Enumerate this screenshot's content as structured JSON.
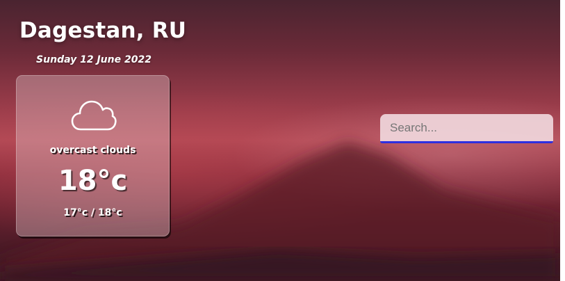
{
  "location": {
    "city": "Dagestan, RU",
    "date": "Sunday 12 June 2022"
  },
  "weather": {
    "icon": "cloud-icon",
    "description": "overcast clouds",
    "temperature": "18°c",
    "range": "17°c / 18°c"
  },
  "search": {
    "placeholder": "Search...",
    "value": ""
  },
  "colors": {
    "search_underline": "#2d2fe0",
    "text": "#ffffff"
  }
}
